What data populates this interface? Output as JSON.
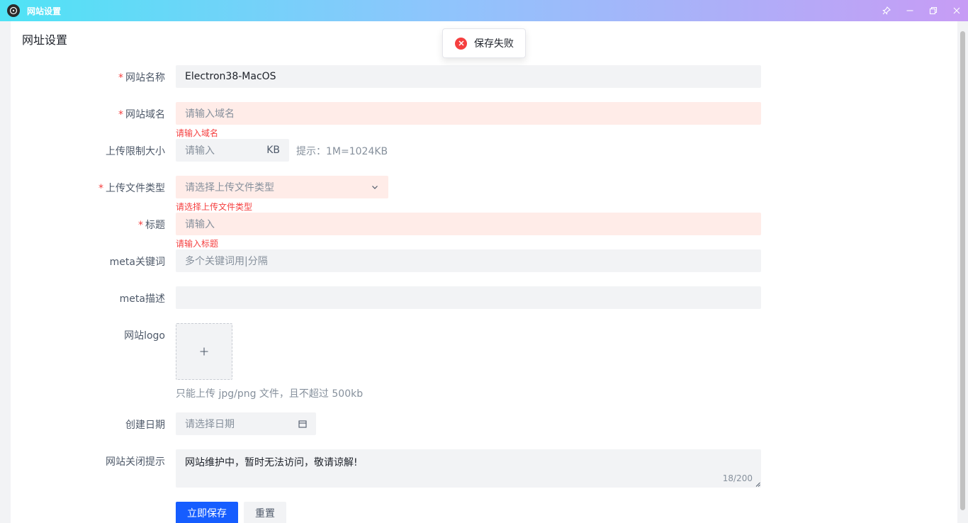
{
  "window": {
    "title": "网站设置"
  },
  "page": {
    "title": "网址设置"
  },
  "toast": {
    "text": "保存失败"
  },
  "form": {
    "site_name": {
      "label": "网站名称",
      "required": "*",
      "value": "Electron38-MacOS"
    },
    "site_domain": {
      "label": "网站域名",
      "required": "*",
      "placeholder": "请输入域名",
      "error": "请输入域名"
    },
    "upload_limit": {
      "label": "上传限制大小",
      "placeholder": "请输入",
      "suffix": "KB",
      "hint": "提示：1M=1024KB"
    },
    "upload_types": {
      "label": "上传文件类型",
      "required": "*",
      "placeholder": "请选择上传文件类型",
      "error": "请选择上传文件类型"
    },
    "title": {
      "label": "标题",
      "required": "*",
      "placeholder": "请输入",
      "error": "请输入标题"
    },
    "meta_keywords": {
      "label": "meta关键词",
      "placeholder": "多个关键词用|分隔"
    },
    "meta_desc": {
      "label": "meta描述",
      "value": ""
    },
    "logo": {
      "label": "网站logo",
      "hint": "只能上传 jpg/png 文件，且不超过 500kb"
    },
    "create_date": {
      "label": "创建日期",
      "placeholder": "请选择日期"
    },
    "close_notice": {
      "label": "网站关闭提示",
      "value": "网站维护中，暂时无法访问，敬请谅解!",
      "counter": "18/200"
    }
  },
  "buttons": {
    "save": "立即保存",
    "reset": "重置"
  },
  "colors": {
    "primary": "#165dff",
    "error": "#f53f3f",
    "error_bg": "#ffece8"
  }
}
